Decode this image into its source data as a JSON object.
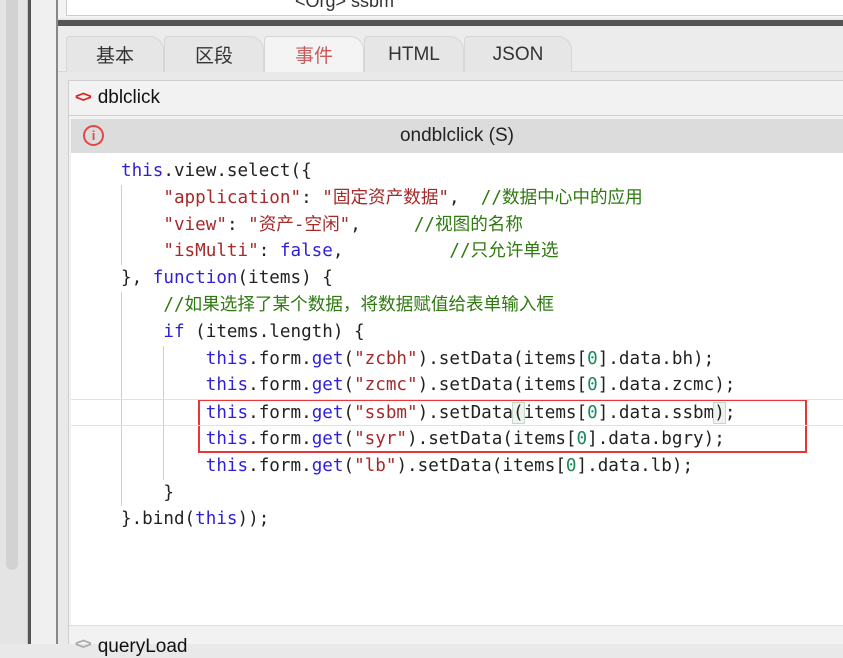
{
  "top_text": "<Org> ssbm",
  "tabs": [
    {
      "label": "基本",
      "active": false
    },
    {
      "label": "区段",
      "active": false
    },
    {
      "label": "事件",
      "active": true
    },
    {
      "label": "HTML",
      "active": false
    },
    {
      "label": "JSON",
      "active": false
    }
  ],
  "event": {
    "name": "dblclick",
    "icon": "code-brackets-icon",
    "function_label": "ondblclick (S)",
    "info_icon": "info-circle-icon"
  },
  "code_lines": [
    {
      "indent": 0,
      "tokens": [
        [
          "kw",
          "this"
        ],
        [
          "pl",
          ".view.select({"
        ]
      ]
    },
    {
      "indent": 1,
      "tokens": [
        [
          "str",
          "\"application\""
        ],
        [
          "pl",
          ": "
        ],
        [
          "str",
          "\"固定资产数据\""
        ],
        [
          "pl",
          ",  "
        ],
        [
          "cm",
          "//数据中心中的应用"
        ]
      ]
    },
    {
      "indent": 1,
      "tokens": [
        [
          "str",
          "\"view\""
        ],
        [
          "pl",
          ": "
        ],
        [
          "str",
          "\"资产-空闲\""
        ],
        [
          "pl",
          ",     "
        ],
        [
          "cm",
          "//视图的名称"
        ]
      ]
    },
    {
      "indent": 1,
      "tokens": [
        [
          "str",
          "\"isMulti\""
        ],
        [
          "pl",
          ": "
        ],
        [
          "kw",
          "false"
        ],
        [
          "pl",
          ",          "
        ],
        [
          "cm",
          "//只允许单选"
        ]
      ]
    },
    {
      "indent": 0,
      "tokens": [
        [
          "pl",
          "}, "
        ],
        [
          "kw",
          "function"
        ],
        [
          "pl",
          "(items) {"
        ]
      ]
    },
    {
      "indent": 1,
      "tokens": [
        [
          "cm",
          "//如果选择了某个数据，将数据赋值给表单输入框"
        ]
      ]
    },
    {
      "indent": 1,
      "tokens": [
        [
          "kw",
          "if"
        ],
        [
          "pl",
          " (items.length) {"
        ]
      ]
    },
    {
      "indent": 2,
      "tokens": [
        [
          "kw",
          "this"
        ],
        [
          "pl",
          ".form."
        ],
        [
          "kw",
          "get"
        ],
        [
          "pl",
          "("
        ],
        [
          "str",
          "\"zcbh\""
        ],
        [
          "pl",
          ").setData(items["
        ],
        [
          "num",
          "0"
        ],
        [
          "pl",
          "].data.bh);"
        ]
      ]
    },
    {
      "indent": 2,
      "tokens": [
        [
          "kw",
          "this"
        ],
        [
          "pl",
          ".form."
        ],
        [
          "kw",
          "get"
        ],
        [
          "pl",
          "("
        ],
        [
          "str",
          "\"zcmc\""
        ],
        [
          "pl",
          ").setData(items["
        ],
        [
          "num",
          "0"
        ],
        [
          "pl",
          "].data.zcmc);"
        ]
      ]
    },
    {
      "indent": 2,
      "active": true,
      "tokens": [
        [
          "kw",
          "this"
        ],
        [
          "pl",
          ".form."
        ],
        [
          "kw",
          "get"
        ],
        [
          "pl",
          "("
        ],
        [
          "str",
          "\"ssbm\""
        ],
        [
          "pl",
          ").setData"
        ],
        [
          "br",
          "("
        ],
        [
          "pl",
          "items["
        ],
        [
          "num",
          "0"
        ],
        [
          "pl",
          "].data.ssbm"
        ],
        [
          "br",
          ")"
        ],
        [
          "pl",
          ";"
        ]
      ]
    },
    {
      "indent": 2,
      "tokens": [
        [
          "kw",
          "this"
        ],
        [
          "pl",
          ".form."
        ],
        [
          "kw",
          "get"
        ],
        [
          "pl",
          "("
        ],
        [
          "str",
          "\"syr\""
        ],
        [
          "pl",
          ").setData(items["
        ],
        [
          "num",
          "0"
        ],
        [
          "pl",
          "].data.bgry);"
        ]
      ]
    },
    {
      "indent": 2,
      "tokens": [
        [
          "kw",
          "this"
        ],
        [
          "pl",
          ".form."
        ],
        [
          "kw",
          "get"
        ],
        [
          "pl",
          "("
        ],
        [
          "str",
          "\"lb\""
        ],
        [
          "pl",
          ").setData(items["
        ],
        [
          "num",
          "0"
        ],
        [
          "pl",
          "].data.lb);"
        ]
      ]
    },
    {
      "indent": 1,
      "tokens": [
        [
          "pl",
          "}"
        ]
      ]
    },
    {
      "indent": 0,
      "tokens": [
        [
          "pl",
          "}.bind("
        ],
        [
          "kw",
          "this"
        ],
        [
          "pl",
          "));"
        ]
      ]
    }
  ],
  "next_event": {
    "name": "queryLoad"
  },
  "highlight_color": "#e8353a"
}
